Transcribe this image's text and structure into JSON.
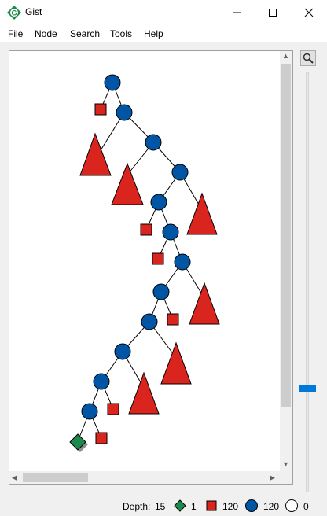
{
  "window": {
    "title": "Gist"
  },
  "menu": [
    "File",
    "Node",
    "Search",
    "Tools",
    "Help"
  ],
  "status": {
    "depth_label": "Depth:",
    "depth_value": "15",
    "solved_count": "1",
    "failed_count": "120",
    "choice_count": "120",
    "open_count": "0"
  },
  "colors": {
    "choice_node": "#0055a5",
    "failed_node": "#d9251e",
    "solved_node": "#1b8a4c",
    "accent": "#0078d7"
  },
  "icons": {
    "app": "gist-logo-icon",
    "zoom": "magnifier-icon",
    "minimize": "minimize-icon",
    "maximize": "maximize-icon",
    "close": "close-icon"
  }
}
